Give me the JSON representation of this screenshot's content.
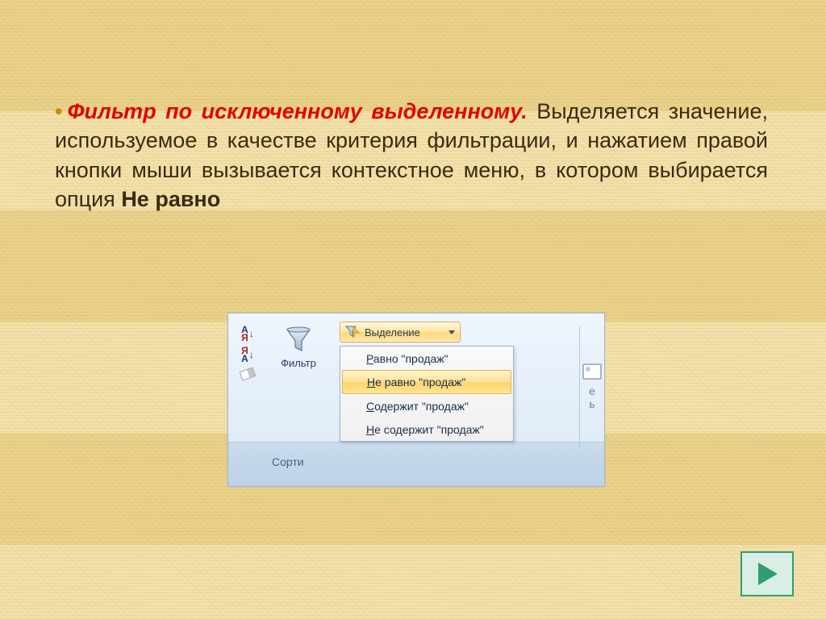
{
  "text": {
    "bullet": "•",
    "title": "Фильтр по исключенному выделенному.",
    "body_before_bold": " Выделяется значение, используемое в качестве критерия фильтрации, и нажатием правой кнопки мыши вызывается контекстное меню, в котором выбирается опция ",
    "bold_option": "Не равно"
  },
  "ribbon": {
    "filter_label": "Фильтр",
    "selection_label": "Выделение",
    "sort_group_label": "Сорти",
    "right_clip_char1": "е",
    "right_clip_char2": "ь",
    "menu_items": [
      {
        "prefix": "Р",
        "rest": "авно \"продаж\"",
        "highlighted": false
      },
      {
        "prefix": "Н",
        "rest": "е равно \"продаж\"",
        "highlighted": true
      },
      {
        "prefix": "С",
        "rest": "одержит \"продаж\"",
        "highlighted": false
      },
      {
        "prefix": "Н",
        "rest": "е содержит \"продаж\"",
        "highlighted": false
      }
    ]
  },
  "nav": {
    "next_label": "next-slide"
  }
}
